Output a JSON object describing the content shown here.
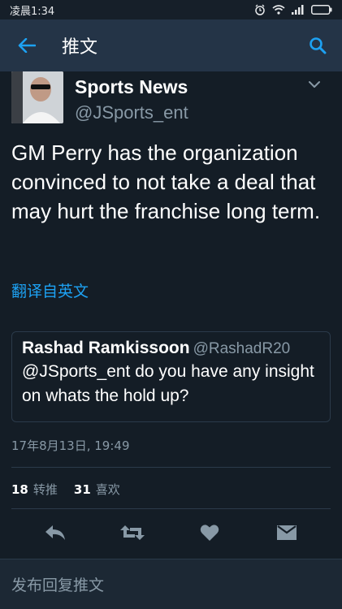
{
  "status_bar": {
    "time": "凌晨1:34"
  },
  "app_bar": {
    "title": "推文"
  },
  "tweet": {
    "author_name": "Sports News",
    "author_handle": "@JSports_ent",
    "text": "GM Perry has the organization convinced to not take a deal that may hurt the franchise long term.",
    "translate_label": "翻译自英文",
    "timestamp": "17年8月13日, 19:49"
  },
  "quoted_tweet": {
    "author_name": "Rashad Ramkissoon",
    "author_handle": "@RashadR20",
    "text": "@JSports_ent do you have any insight on whats the hold up?"
  },
  "stats": {
    "retweets_count": "18",
    "retweets_label": "转推",
    "likes_count": "31",
    "likes_label": "喜欢"
  },
  "reply_bar": {
    "placeholder": "发布回复推文"
  },
  "colors": {
    "background": "#141d26",
    "app_bar": "#243447",
    "accent": "#1da1f2",
    "secondary_text": "#8899a6"
  },
  "icons": [
    "back-arrow-icon",
    "search-icon",
    "chevron-down-icon",
    "reply-icon",
    "retweet-icon",
    "heart-icon",
    "direct-message-icon",
    "alarm-icon",
    "wifi-icon",
    "signal-icon",
    "battery-icon"
  ]
}
